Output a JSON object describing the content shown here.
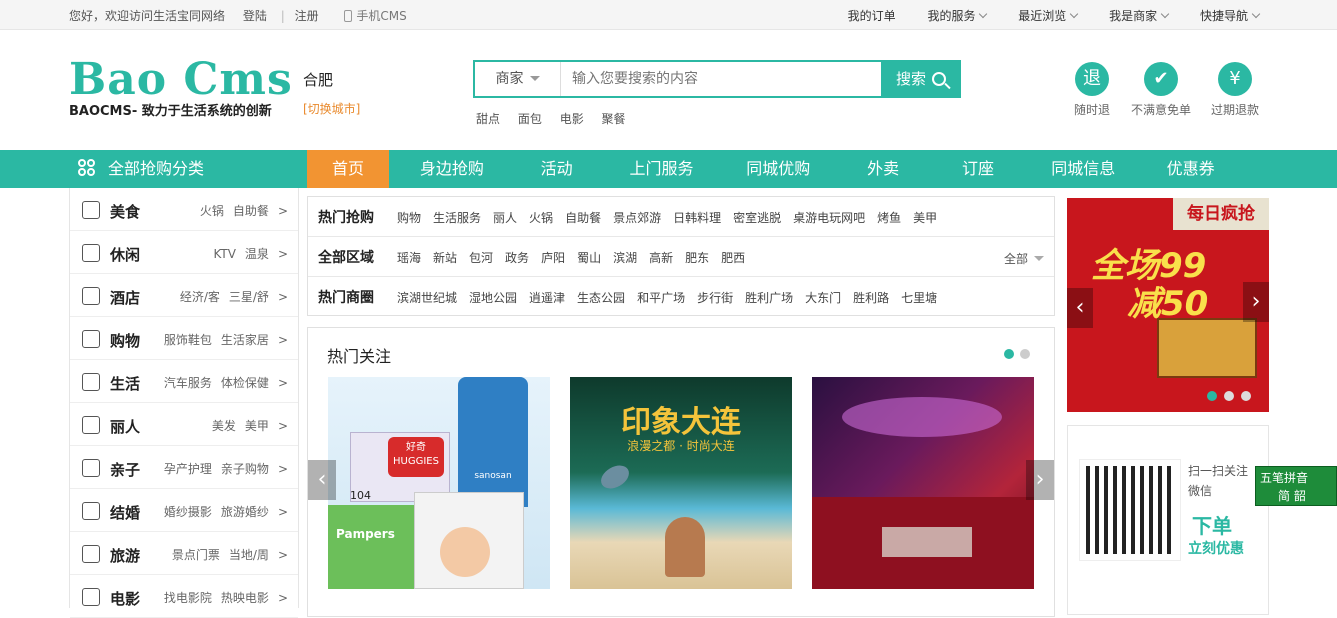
{
  "topbar": {
    "welcome": "您好，欢迎访问生活宝同网络",
    "login": "登陆",
    "register": "注册",
    "mobile": "手机CMS",
    "right": [
      "我的订单",
      "我的服务",
      "最近浏览",
      "我是商家",
      "快捷导航"
    ]
  },
  "logo": {
    "main": "Bao Cms",
    "sub": "BAOCMS- 致力于生活系统的创新"
  },
  "city": {
    "name": "合肥",
    "switch": "[切换城市]"
  },
  "search": {
    "scope": "商家",
    "placeholder": "输入您要搜索的内容",
    "button": "搜索",
    "hotwords": [
      "甜点",
      "面包",
      "电影",
      "聚餐"
    ]
  },
  "guarantees": [
    {
      "icon_text": "退",
      "label": "随时退"
    },
    {
      "icon_text": "✔",
      "label": "不满意免单"
    },
    {
      "icon_text": "¥",
      "label": "过期退款"
    }
  ],
  "nav": {
    "all_categories": "全部抢购分类",
    "items": [
      "首页",
      "身边抢购",
      "活动",
      "上门服务",
      "同城优购",
      "外卖",
      "订座",
      "同城信息",
      "优惠券"
    ]
  },
  "categories": [
    {
      "name": "美食",
      "subs": [
        "火锅",
        "自助餐"
      ],
      "icon": "food-icon"
    },
    {
      "name": "休闲",
      "subs": [
        "KTV",
        "温泉"
      ],
      "icon": "leisure-icon"
    },
    {
      "name": "酒店",
      "subs": [
        "经济/客",
        "三星/舒"
      ],
      "icon": "hotel-icon"
    },
    {
      "name": "购物",
      "subs": [
        "服饰鞋包",
        "生活家居"
      ],
      "icon": "shopping-bag-icon"
    },
    {
      "name": "生活",
      "subs": [
        "汽车服务",
        "体检保健"
      ],
      "icon": "umbrella-icon"
    },
    {
      "name": "丽人",
      "subs": [
        "美发",
        "美甲"
      ],
      "icon": "beauty-icon"
    },
    {
      "name": "亲子",
      "subs": [
        "孕产护理",
        "亲子购物"
      ],
      "icon": "parent-child-icon"
    },
    {
      "name": "结婚",
      "subs": [
        "婚纱摄影",
        "旅游婚纱"
      ],
      "icon": "diamond-icon"
    },
    {
      "name": "旅游",
      "subs": [
        "景点门票",
        "当地/周"
      ],
      "icon": "palm-tree-icon"
    },
    {
      "name": "电影",
      "subs": [
        "找电影院",
        "热映电影"
      ],
      "icon": "film-icon"
    }
  ],
  "filters": [
    {
      "title": "热门抢购",
      "items": [
        "购物",
        "生活服务",
        "丽人",
        "火锅",
        "自助餐",
        "景点郊游",
        "日韩料理",
        "密室逃脱",
        "桌游电玩网吧",
        "烤鱼",
        "美甲"
      ]
    },
    {
      "title": "全部区域",
      "items": [
        "瑶海",
        "新站",
        "包河",
        "政务",
        "庐阳",
        "蜀山",
        "滨湖",
        "高新",
        "肥东",
        "肥西"
      ],
      "all": "全部"
    },
    {
      "title": "热门商圈",
      "items": [
        "滨湖世纪城",
        "湿地公园",
        "逍遥津",
        "生态公园",
        "和平广场",
        "步行街",
        "胜利广场",
        "大东门",
        "胜利路",
        "七里塘"
      ]
    }
  ],
  "hot": {
    "title": "热门关注",
    "pictures": [
      {
        "labels": [
          "好奇",
          "HUGGIES",
          "sanosan",
          "104",
          "Pampers"
        ]
      },
      {
        "labels": [
          "印象大连",
          "浪漫之都 · 时尚大连"
        ]
      },
      {
        "labels": []
      }
    ]
  },
  "ad": {
    "badge": "每日疯抢",
    "line1": "全场99",
    "line2": "减50"
  },
  "qr": {
    "line1": "扫一扫关注",
    "line2": "微信",
    "promo1": "下单",
    "promo2": "立刻优惠"
  },
  "float_widget": {
    "line1": "五笔拼音",
    "line2": "简 韶"
  },
  "colors": {
    "accent": "#2bb8a3",
    "active_nav": "#f29432",
    "ad_red": "#c8161d"
  }
}
